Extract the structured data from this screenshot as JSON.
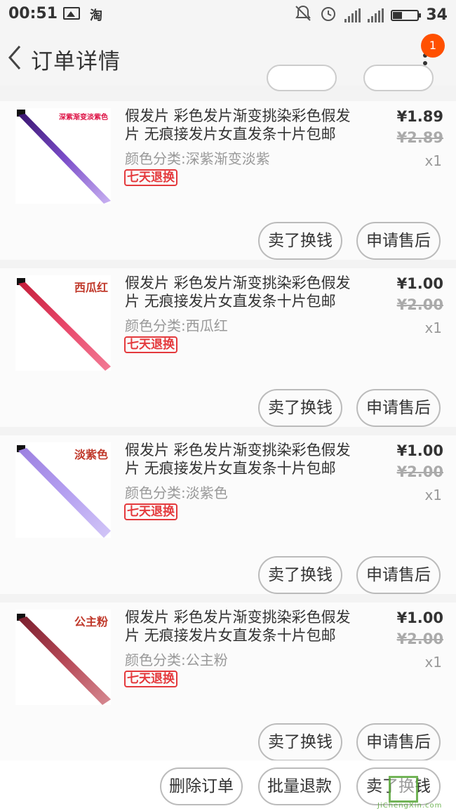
{
  "status_bar": {
    "time": "00:51",
    "app_glyph": "淘",
    "battery_level": "34",
    "icons": [
      "image-icon",
      "taobao-icon",
      "mute-icon",
      "alarm-icon",
      "signal-icon",
      "signal-icon",
      "battery-icon"
    ]
  },
  "header": {
    "title": "订单详情",
    "notification_count": "1"
  },
  "items": [
    {
      "title": "假发片 彩色发片渐变挑染彩色假发片 无痕接发片女直发条十片包邮",
      "spec": "颜色分类:深紫渐变淡紫",
      "tag": "七天退换",
      "price": "¥1.89",
      "original_price": "¥2.89",
      "quantity": "x1",
      "thumb_label": "深紫渐变淡紫色",
      "thumb_colors": [
        "#3a1570",
        "#7a4cc8",
        "#c9b2f2"
      ],
      "sell_label": "卖了换钱",
      "after_sale_label": "申请售后"
    },
    {
      "title": "假发片 彩色发片渐变挑染彩色假发片 无痕接发片女直发条十片包邮",
      "spec": "颜色分类:西瓜红",
      "tag": "七天退换",
      "price": "¥1.00",
      "original_price": "¥2.00",
      "quantity": "x1",
      "thumb_label": "西瓜红",
      "thumb_colors": [
        "#c41e3a",
        "#e8476a",
        "#f27b95"
      ],
      "sell_label": "卖了换钱",
      "after_sale_label": "申请售后"
    },
    {
      "title": "假发片 彩色发片渐变挑染彩色假发片 无痕接发片女直发条十片包邮",
      "spec": "颜色分类:淡紫色",
      "tag": "七天退换",
      "price": "¥1.00",
      "original_price": "¥2.00",
      "quantity": "x1",
      "thumb_label": "淡紫色",
      "thumb_colors": [
        "#9b7fe0",
        "#b49ff0",
        "#d2c6f7"
      ],
      "sell_label": "卖了换钱",
      "after_sale_label": "申请售后"
    },
    {
      "title": "假发片 彩色发片渐变挑染彩色假发片 无痕接发片女直发条十片包邮",
      "spec": "颜色分类:公主粉",
      "tag": "七天退换",
      "price": "¥1.00",
      "original_price": "¥2.00",
      "quantity": "x1",
      "thumb_label": "公主粉",
      "thumb_colors": [
        "#7a1f2e",
        "#b54856",
        "#d68a92"
      ],
      "sell_label": "卖了换钱",
      "after_sale_label": "申请售后"
    }
  ],
  "bottom_bar": {
    "delete_label": "删除订单",
    "bulk_refund_label": "批量退款",
    "sell_label": "卖了换钱"
  },
  "watermark_text": "JiChengXin.com",
  "colors": {
    "accent": "#ff5000",
    "tag_red": "#e4393c"
  }
}
